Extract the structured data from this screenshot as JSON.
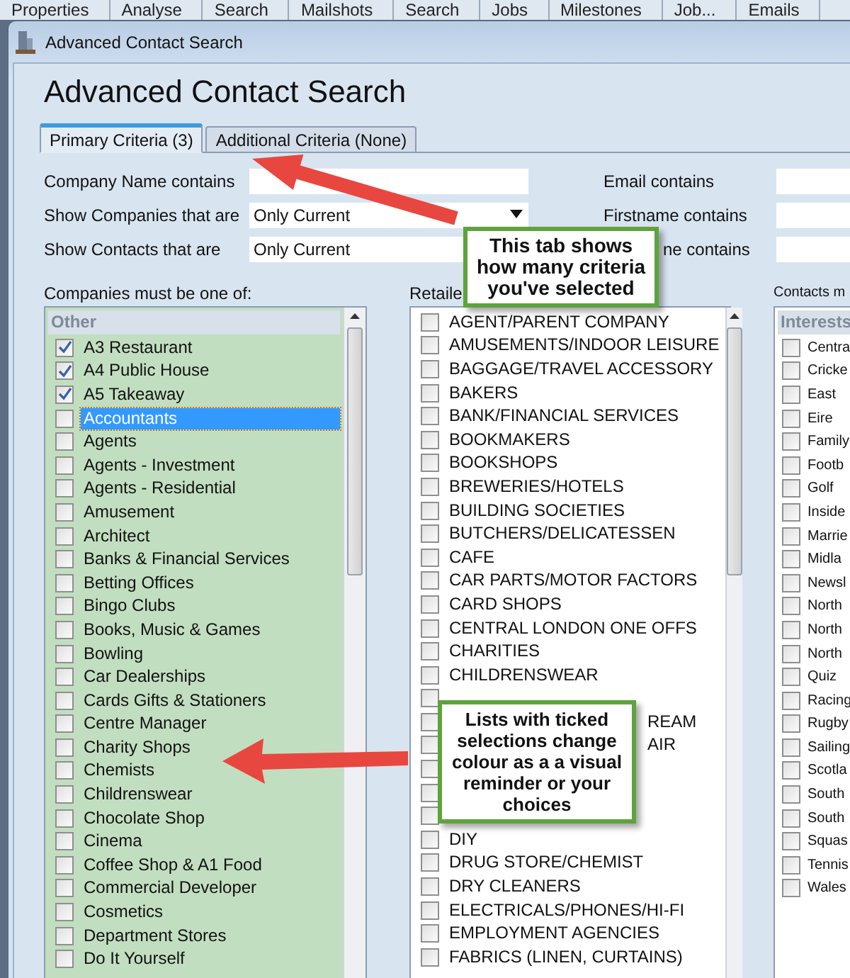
{
  "ribbon": [
    "Properties",
    "Analyse",
    "Search",
    "Mailshots",
    "Search",
    "Jobs",
    "Milestones",
    "Job...",
    "Emails"
  ],
  "window": {
    "title": "Advanced Contact Search"
  },
  "heading": "Advanced Contact Search",
  "tabs": [
    {
      "label": "Primary Criteria (3)",
      "selected": true
    },
    {
      "label": "Additional Criteria (None)",
      "selected": false
    }
  ],
  "fields_left": [
    {
      "label": "Company Name contains",
      "kind": "text"
    },
    {
      "label": "Show Companies that are",
      "kind": "dropdown",
      "value": "Only Current"
    },
    {
      "label": "Show Contacts that are",
      "kind": "text",
      "value": "Only Current"
    }
  ],
  "fields_right": [
    {
      "label": "Email contains"
    },
    {
      "label": "Firstname contains"
    },
    {
      "label": "ne contains",
      "covered": true
    }
  ],
  "lists": [
    {
      "label": "Companies must be one of:",
      "group": "Other",
      "scrollable": true,
      "items": [
        {
          "label": "A3 Restaurant",
          "checked": true,
          "selected": false
        },
        {
          "label": "A4 Public House",
          "checked": true,
          "selected": false
        },
        {
          "label": "A5 Takeaway",
          "checked": true,
          "selected": false
        },
        {
          "label": "Accountants",
          "checked": false,
          "selected": true
        },
        {
          "label": "Agents",
          "checked": false,
          "selected": false
        },
        {
          "label": "Agents - Investment",
          "checked": false,
          "selected": false
        },
        {
          "label": "Agents - Residential",
          "checked": false,
          "selected": false
        },
        {
          "label": "Amusement",
          "checked": false,
          "selected": false
        },
        {
          "label": "Architect",
          "checked": false,
          "selected": false
        },
        {
          "label": "Banks & Financial Services",
          "checked": false,
          "selected": false
        },
        {
          "label": "Betting Offices",
          "checked": false,
          "selected": false
        },
        {
          "label": "Bingo Clubs",
          "checked": false,
          "selected": false
        },
        {
          "label": "Books, Music & Games",
          "checked": false,
          "selected": false
        },
        {
          "label": "Bowling",
          "checked": false,
          "selected": false
        },
        {
          "label": "Car Dealerships",
          "checked": false,
          "selected": false
        },
        {
          "label": "Cards Gifts & Stationers",
          "checked": false,
          "selected": false
        },
        {
          "label": "Centre Manager",
          "checked": false,
          "selected": false
        },
        {
          "label": "Charity Shops",
          "checked": false,
          "selected": false
        },
        {
          "label": "Chemists",
          "checked": false,
          "selected": false
        },
        {
          "label": "Childrenswear",
          "checked": false,
          "selected": false
        },
        {
          "label": "Chocolate Shop",
          "checked": false,
          "selected": false
        },
        {
          "label": "Cinema",
          "checked": false,
          "selected": false
        },
        {
          "label": "Coffee Shop & A1 Food",
          "checked": false,
          "selected": false
        },
        {
          "label": "Commercial Developer",
          "checked": false,
          "selected": false
        },
        {
          "label": "Cosmetics",
          "checked": false,
          "selected": false
        },
        {
          "label": "Department Stores",
          "checked": false,
          "selected": false
        },
        {
          "label": "Do It Yourself",
          "checked": false,
          "selected": false
        }
      ]
    },
    {
      "label": "Retaile",
      "scrollable": true,
      "items": [
        {
          "label": "AGENT/PARENT COMPANY",
          "checked": false,
          "selected": false
        },
        {
          "label": "AMUSEMENTS/INDOOR LEISURE",
          "checked": false,
          "selected": false
        },
        {
          "label": "BAGGAGE/TRAVEL ACCESSORY",
          "checked": false,
          "selected": false
        },
        {
          "label": "BAKERS",
          "checked": false,
          "selected": false
        },
        {
          "label": "BANK/FINANCIAL SERVICES",
          "checked": false,
          "selected": false
        },
        {
          "label": "BOOKMAKERS",
          "checked": false,
          "selected": false
        },
        {
          "label": "BOOKSHOPS",
          "checked": false,
          "selected": false
        },
        {
          "label": "BREWERIES/HOTELS",
          "checked": false,
          "selected": false
        },
        {
          "label": "BUILDING SOCIETIES",
          "checked": false,
          "selected": false
        },
        {
          "label": "BUTCHERS/DELICATESSEN",
          "checked": false,
          "selected": false
        },
        {
          "label": "CAFE",
          "checked": false,
          "selected": false
        },
        {
          "label": "CAR PARTS/MOTOR FACTORS",
          "checked": false,
          "selected": false
        },
        {
          "label": "CARD SHOPS",
          "checked": false,
          "selected": false
        },
        {
          "label": "CENTRAL LONDON ONE OFFS",
          "checked": false,
          "selected": false
        },
        {
          "label": "CHARITIES",
          "checked": false,
          "selected": false
        },
        {
          "label": "CHILDRENSWEAR",
          "checked": false,
          "selected": false
        },
        {
          "checked": false
        },
        {
          "label": "REAM",
          "covered": true,
          "checked": false,
          "selected": false
        },
        {
          "label": "AIR",
          "covered": true,
          "checked": false,
          "selected": false
        },
        {
          "checked": false
        },
        {
          "checked": false
        },
        {
          "checked": false
        },
        {
          "label": "DIY",
          "checked": false,
          "selected": false
        },
        {
          "label": "DRUG STORE/CHEMIST",
          "checked": false,
          "selected": false
        },
        {
          "label": "DRY CLEANERS",
          "checked": false,
          "selected": false
        },
        {
          "label": "ELECTRICALS/PHONES/HI-FI",
          "checked": false,
          "selected": false
        },
        {
          "label": "EMPLOYMENT AGENCIES",
          "checked": false,
          "selected": false
        },
        {
          "label": "FABRICS (LINEN, CURTAINS)",
          "checked": false,
          "selected": false
        }
      ]
    },
    {
      "label": "Contacts m",
      "group": "Interests",
      "items": [
        {
          "label": "Centra",
          "checked": false,
          "selected": false
        },
        {
          "label": "Cricke",
          "checked": false,
          "selected": false
        },
        {
          "label": "East",
          "checked": false,
          "selected": false
        },
        {
          "label": "Eire",
          "checked": false,
          "selected": false
        },
        {
          "label": "Family",
          "checked": false,
          "selected": false
        },
        {
          "label": "Footb",
          "checked": false,
          "selected": false
        },
        {
          "label": "Golf",
          "checked": false,
          "selected": false
        },
        {
          "label": "Inside",
          "checked": false,
          "selected": false
        },
        {
          "label": "Marrie",
          "checked": false,
          "selected": false
        },
        {
          "label": "Midla",
          "checked": false,
          "selected": false
        },
        {
          "label": "Newsl",
          "checked": false,
          "selected": false
        },
        {
          "label": "North",
          "checked": false,
          "selected": false
        },
        {
          "label": "North",
          "checked": false,
          "selected": false
        },
        {
          "label": "North",
          "checked": false,
          "selected": false
        },
        {
          "label": "Quiz",
          "checked": false,
          "selected": false
        },
        {
          "label": "Racing",
          "checked": false,
          "selected": false
        },
        {
          "label": "Rugby",
          "checked": false,
          "selected": false
        },
        {
          "label": "Sailing",
          "checked": false,
          "selected": false
        },
        {
          "label": "Scotla",
          "checked": false,
          "selected": false
        },
        {
          "label": "South",
          "checked": false,
          "selected": false
        },
        {
          "label": "South",
          "checked": false,
          "selected": false
        },
        {
          "label": "Squas",
          "checked": false,
          "selected": false
        },
        {
          "label": "Tennis",
          "checked": false,
          "selected": false
        },
        {
          "label": "Wales",
          "checked": false,
          "selected": false
        }
      ]
    }
  ],
  "callouts": [
    "This tab shows how many criteria you've selected",
    "Lists with ticked selections change colour as a a visual reminder or your choices"
  ]
}
